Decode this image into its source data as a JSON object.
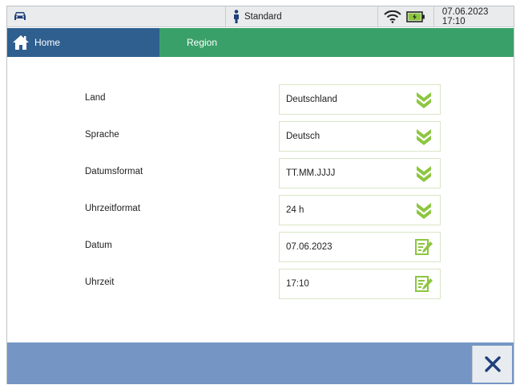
{
  "status_bar": {
    "car_icon": "car-icon",
    "profile_icon": "person-icon",
    "profile_label": "Standard",
    "wifi_icon": "wifi-icon",
    "battery_icon": "battery-charging-icon",
    "datetime": "07.06.2023 17:10"
  },
  "breadcrumb": {
    "home_icon": "home-icon",
    "home_label": "Home",
    "current_label": "Region"
  },
  "settings": [
    {
      "label": "Land",
      "value": "Deutschland",
      "control": "dropdown",
      "icon": "chevron-double-down-icon"
    },
    {
      "label": "Sprache",
      "value": "Deutsch",
      "control": "dropdown",
      "icon": "chevron-double-down-icon"
    },
    {
      "label": "Datumsformat",
      "value": "TT.MM.JJJJ",
      "control": "dropdown",
      "icon": "chevron-double-down-icon"
    },
    {
      "label": "Uhrzeitformat",
      "value": "24 h",
      "control": "dropdown",
      "icon": "chevron-double-down-icon"
    },
    {
      "label": "Datum",
      "value": "07.06.2023",
      "control": "edit",
      "icon": "edit-icon"
    },
    {
      "label": "Uhrzeit",
      "value": "17:10",
      "control": "edit",
      "icon": "edit-icon"
    }
  ],
  "footer": {
    "close_icon": "close-icon"
  },
  "colors": {
    "home_crumb": "#2f5f8f",
    "current_crumb": "#3aa06a",
    "accent_green": "#8cc63f",
    "bottom_bar": "#7595c5",
    "close_x": "#1f3f7a"
  }
}
